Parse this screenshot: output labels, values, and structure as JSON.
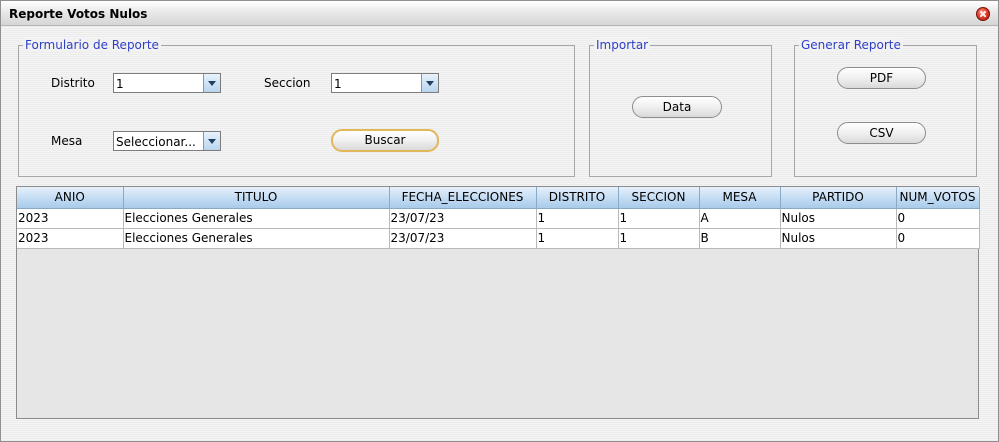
{
  "window": {
    "title": "Reporte Votos Nulos"
  },
  "form": {
    "legend": "Formulario de Reporte",
    "distrito_label": "Distrito",
    "distrito_value": "1",
    "seccion_label": "Seccion",
    "seccion_value": "1",
    "mesa_label": "Mesa",
    "mesa_value": "Seleccionar...",
    "buscar_label": "Buscar"
  },
  "importar": {
    "legend": "Importar",
    "data_label": "Data"
  },
  "generar": {
    "legend": "Generar Reporte",
    "pdf_label": "PDF",
    "csv_label": "CSV"
  },
  "table": {
    "columns": [
      "ANIO",
      "TITULO",
      "FECHA_ELECCIONES",
      "DISTRITO",
      "SECCION",
      "MESA",
      "PARTIDO",
      "NUM_VOTOS"
    ],
    "rows": [
      [
        "2023",
        "Elecciones Generales",
        "23/07/23",
        "1",
        "1",
        "A",
        "Nulos",
        "0"
      ],
      [
        "2023",
        "Elecciones Generales",
        "23/07/23",
        "1",
        "1",
        "B",
        "Nulos",
        "0"
      ]
    ]
  },
  "colors": {
    "legend": "#2f40c8",
    "header_blue": "#bfd9f2",
    "close_red": "#e0402a"
  },
  "icons": {
    "close": "close-icon",
    "dropdown": "chevron-down-icon"
  }
}
